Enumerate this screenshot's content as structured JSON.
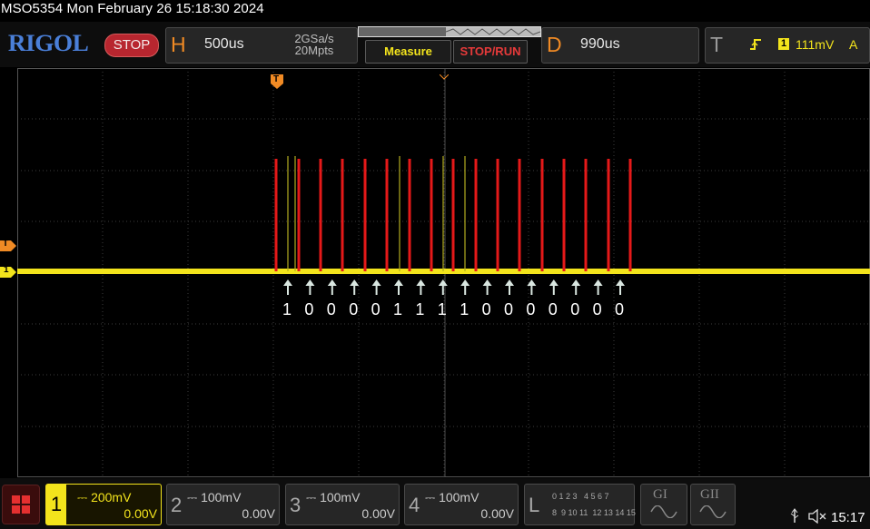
{
  "titlebar": {
    "text": "MSO5354  Mon February 26 15:18:30 2024"
  },
  "topbar": {
    "logo": "RIGOL",
    "run_state": "STOP",
    "horizontal": {
      "letter": "H",
      "timebase": "500us",
      "sample_rate": "2GSa/s",
      "memory_depth": "20Mpts"
    },
    "measure_label": "Measure",
    "stoprun_label": "STOP/RUN",
    "delay": {
      "letter": "D",
      "value": "990us"
    },
    "trigger": {
      "letter": "T",
      "source": "1",
      "level": "111mV",
      "mode": "A"
    }
  },
  "markers": {
    "trigger_pos": "T",
    "trigger_level": "T",
    "ch1_offset": "1"
  },
  "signal": {
    "color": "#f3e41c",
    "decode_color": "#e51919",
    "bits": [
      "1",
      "0",
      "0",
      "0",
      "0",
      "1",
      "1",
      "1",
      "1",
      "0",
      "0",
      "0",
      "0",
      "0",
      "0",
      "0"
    ]
  },
  "channels": [
    {
      "num": "1",
      "scale": "200mV",
      "offset": "0.00V",
      "active": true
    },
    {
      "num": "2",
      "scale": "100mV",
      "offset": "0.00V",
      "active": false
    },
    {
      "num": "3",
      "scale": "100mV",
      "offset": "0.00V",
      "active": false
    },
    {
      "num": "4",
      "scale": "100mV",
      "offset": "0.00V",
      "active": false
    }
  ],
  "logic": {
    "letter": "L",
    "row1": "0 1 2 3   4 5 6 7",
    "row2": "8  9 10 11  12 13 14 15"
  },
  "generators": [
    {
      "label": "GI"
    },
    {
      "label": "GII"
    }
  ],
  "status": {
    "time": "15:17"
  }
}
